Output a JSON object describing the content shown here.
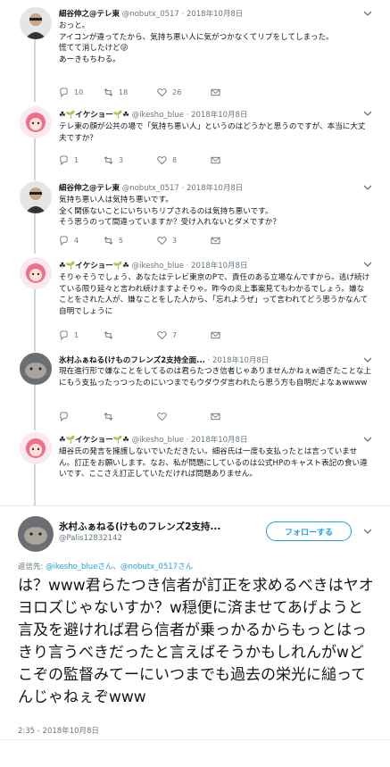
{
  "tweets": [
    {
      "name": "細谷伸之@テレ東",
      "handle": "@nobutx_0517",
      "date": "2018年10月8日",
      "lines": [
        "おっと。",
        "アイコンが違ってたから、気持ち悪い人に気がつかなくてリプをしてしまった。",
        "慌てて消したけど😜",
        "あーきもちわる。"
      ],
      "replies": "10",
      "retweets": "18",
      "likes": "26"
    },
    {
      "name": "☘🌱イケショー🌱☘",
      "handle": "@ikesho_blue",
      "date": "2018年10月8日",
      "lines": [
        "テレ東の顔が公共の場で「気持ち悪い人」というのはどうかと思うのですが、本当に大丈夫ですか？"
      ],
      "replies": "1",
      "retweets": "3",
      "likes": "8"
    },
    {
      "name": "細谷伸之@テレ東",
      "handle": "@nobutx_0517",
      "date": "2018年10月8日",
      "lines": [
        "気持ち悪い人は気持ち悪いです。",
        "全く関係ないことにいちいちリプされるのは気持ち悪いです。",
        "そう思うのって間違っていますか？受け入れないとダメですか？"
      ],
      "replies": "4",
      "retweets": "5",
      "likes": "3"
    },
    {
      "name": "☘🌱イケショー🌱☘",
      "handle": "@ikesho_blue",
      "date": "2018年10月8日",
      "lines": [
        "そりゃそうでしょう、あなたはテレビ東京のPで、責任のある立場なんですから。逃げ続けている限り延々と言われ続けますよそりゃ。昨今の炎上事案見てもわかるでしょう。嫌なことをされた人が、嫌なことをした人から、「忘れようぜ」って言われてどう思うかなんて自明でしょうに"
      ],
      "replies": "1",
      "retweets": "",
      "likes": "7"
    },
    {
      "name": "氷村ふぁねる(けものフレンズ2支持全面...",
      "handle": "",
      "date": "2018年10月8日",
      "lines": [
        "現在進行形で嫌なことをしてるのは君らたつき信者じゃありませんかねぇw過ぎたことな上にもう支払ったっつったのにいつまでもウダウダ言われたら思う方も自明だよなぁwwww"
      ],
      "replies": "",
      "retweets": "",
      "likes": ""
    },
    {
      "name": "☘🌱イケショー🌱☘",
      "handle": "@ikesho_blue",
      "date": "2018年10月8日",
      "lines": [
        "細谷氏の発言を擁護しないでいただきたい。細谷氏は一度も支払ったとは言っていません。訂正をお願いします。なお、私が問題にしているのは公式HPのキャスト表記の食い違いです、ここさえ訂正していただければ問題ありません。"
      ],
      "replies": "",
      "retweets": "",
      "likes": ""
    }
  ],
  "main": {
    "name": "氷村ふぁねる(けものフレンズ2支持...",
    "handle": "@Palis12832142",
    "follow_label": "フォローする",
    "reply_to_prefix": "返信先: ",
    "reply_to_1": "@ikesho_blueさん",
    "reply_to_and": "、",
    "reply_to_2": "@nobutx_0517さん",
    "text": "は？www君らたつき信者が訂正を求めるべきはヤオヨロズじゃないすか？w穏便に済ませてあげようと言及を避ければ君ら信者が乗っかるからもっとはっきり言うべきだったと言えばそうかもしれんがwどこぞの監督みてーにいつまでも過去の栄光に縋ってんじゃねぇぞwww",
    "timestamp": "2:35 - 2018年10月8日"
  }
}
